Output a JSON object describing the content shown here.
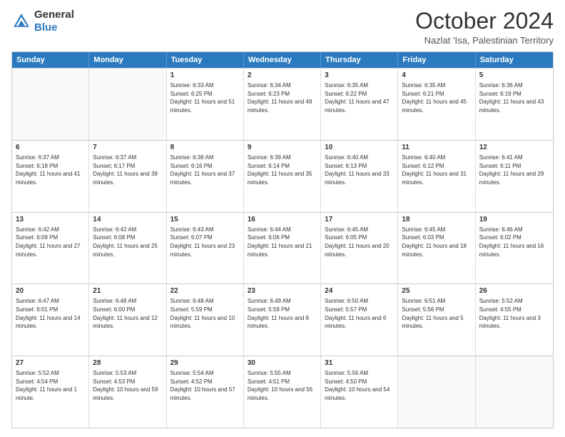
{
  "header": {
    "logo_line1": "General",
    "logo_line2": "Blue",
    "month_title": "October 2024",
    "subtitle": "Nazlat 'Isa, Palestinian Territory"
  },
  "weekdays": [
    "Sunday",
    "Monday",
    "Tuesday",
    "Wednesday",
    "Thursday",
    "Friday",
    "Saturday"
  ],
  "rows": [
    [
      {
        "day": "",
        "text": ""
      },
      {
        "day": "",
        "text": ""
      },
      {
        "day": "1",
        "text": "Sunrise: 6:33 AM\nSunset: 6:25 PM\nDaylight: 11 hours and 51 minutes."
      },
      {
        "day": "2",
        "text": "Sunrise: 6:34 AM\nSunset: 6:23 PM\nDaylight: 11 hours and 49 minutes."
      },
      {
        "day": "3",
        "text": "Sunrise: 6:35 AM\nSunset: 6:22 PM\nDaylight: 11 hours and 47 minutes."
      },
      {
        "day": "4",
        "text": "Sunrise: 6:35 AM\nSunset: 6:21 PM\nDaylight: 11 hours and 45 minutes."
      },
      {
        "day": "5",
        "text": "Sunrise: 6:36 AM\nSunset: 6:19 PM\nDaylight: 11 hours and 43 minutes."
      }
    ],
    [
      {
        "day": "6",
        "text": "Sunrise: 6:37 AM\nSunset: 6:18 PM\nDaylight: 11 hours and 41 minutes."
      },
      {
        "day": "7",
        "text": "Sunrise: 6:37 AM\nSunset: 6:17 PM\nDaylight: 11 hours and 39 minutes."
      },
      {
        "day": "8",
        "text": "Sunrise: 6:38 AM\nSunset: 6:16 PM\nDaylight: 11 hours and 37 minutes."
      },
      {
        "day": "9",
        "text": "Sunrise: 6:39 AM\nSunset: 6:14 PM\nDaylight: 11 hours and 35 minutes."
      },
      {
        "day": "10",
        "text": "Sunrise: 6:40 AM\nSunset: 6:13 PM\nDaylight: 11 hours and 33 minutes."
      },
      {
        "day": "11",
        "text": "Sunrise: 6:40 AM\nSunset: 6:12 PM\nDaylight: 11 hours and 31 minutes."
      },
      {
        "day": "12",
        "text": "Sunrise: 6:41 AM\nSunset: 6:11 PM\nDaylight: 11 hours and 29 minutes."
      }
    ],
    [
      {
        "day": "13",
        "text": "Sunrise: 6:42 AM\nSunset: 6:09 PM\nDaylight: 11 hours and 27 minutes."
      },
      {
        "day": "14",
        "text": "Sunrise: 6:42 AM\nSunset: 6:08 PM\nDaylight: 11 hours and 25 minutes."
      },
      {
        "day": "15",
        "text": "Sunrise: 6:43 AM\nSunset: 6:07 PM\nDaylight: 11 hours and 23 minutes."
      },
      {
        "day": "16",
        "text": "Sunrise: 6:44 AM\nSunset: 6:06 PM\nDaylight: 11 hours and 21 minutes."
      },
      {
        "day": "17",
        "text": "Sunrise: 6:45 AM\nSunset: 6:05 PM\nDaylight: 11 hours and 20 minutes."
      },
      {
        "day": "18",
        "text": "Sunrise: 6:45 AM\nSunset: 6:03 PM\nDaylight: 11 hours and 18 minutes."
      },
      {
        "day": "19",
        "text": "Sunrise: 6:46 AM\nSunset: 6:02 PM\nDaylight: 11 hours and 16 minutes."
      }
    ],
    [
      {
        "day": "20",
        "text": "Sunrise: 6:47 AM\nSunset: 6:01 PM\nDaylight: 11 hours and 14 minutes."
      },
      {
        "day": "21",
        "text": "Sunrise: 6:48 AM\nSunset: 6:00 PM\nDaylight: 11 hours and 12 minutes."
      },
      {
        "day": "22",
        "text": "Sunrise: 6:48 AM\nSunset: 5:59 PM\nDaylight: 11 hours and 10 minutes."
      },
      {
        "day": "23",
        "text": "Sunrise: 6:49 AM\nSunset: 5:58 PM\nDaylight: 11 hours and 8 minutes."
      },
      {
        "day": "24",
        "text": "Sunrise: 6:50 AM\nSunset: 5:57 PM\nDaylight: 11 hours and 6 minutes."
      },
      {
        "day": "25",
        "text": "Sunrise: 6:51 AM\nSunset: 5:56 PM\nDaylight: 11 hours and 5 minutes."
      },
      {
        "day": "26",
        "text": "Sunrise: 5:52 AM\nSunset: 4:55 PM\nDaylight: 11 hours and 3 minutes."
      }
    ],
    [
      {
        "day": "27",
        "text": "Sunrise: 5:52 AM\nSunset: 4:54 PM\nDaylight: 11 hours and 1 minute."
      },
      {
        "day": "28",
        "text": "Sunrise: 5:53 AM\nSunset: 4:53 PM\nDaylight: 10 hours and 59 minutes."
      },
      {
        "day": "29",
        "text": "Sunrise: 5:54 AM\nSunset: 4:52 PM\nDaylight: 10 hours and 57 minutes."
      },
      {
        "day": "30",
        "text": "Sunrise: 5:55 AM\nSunset: 4:51 PM\nDaylight: 10 hours and 56 minutes."
      },
      {
        "day": "31",
        "text": "Sunrise: 5:56 AM\nSunset: 4:50 PM\nDaylight: 10 hours and 54 minutes."
      },
      {
        "day": "",
        "text": ""
      },
      {
        "day": "",
        "text": ""
      }
    ]
  ]
}
